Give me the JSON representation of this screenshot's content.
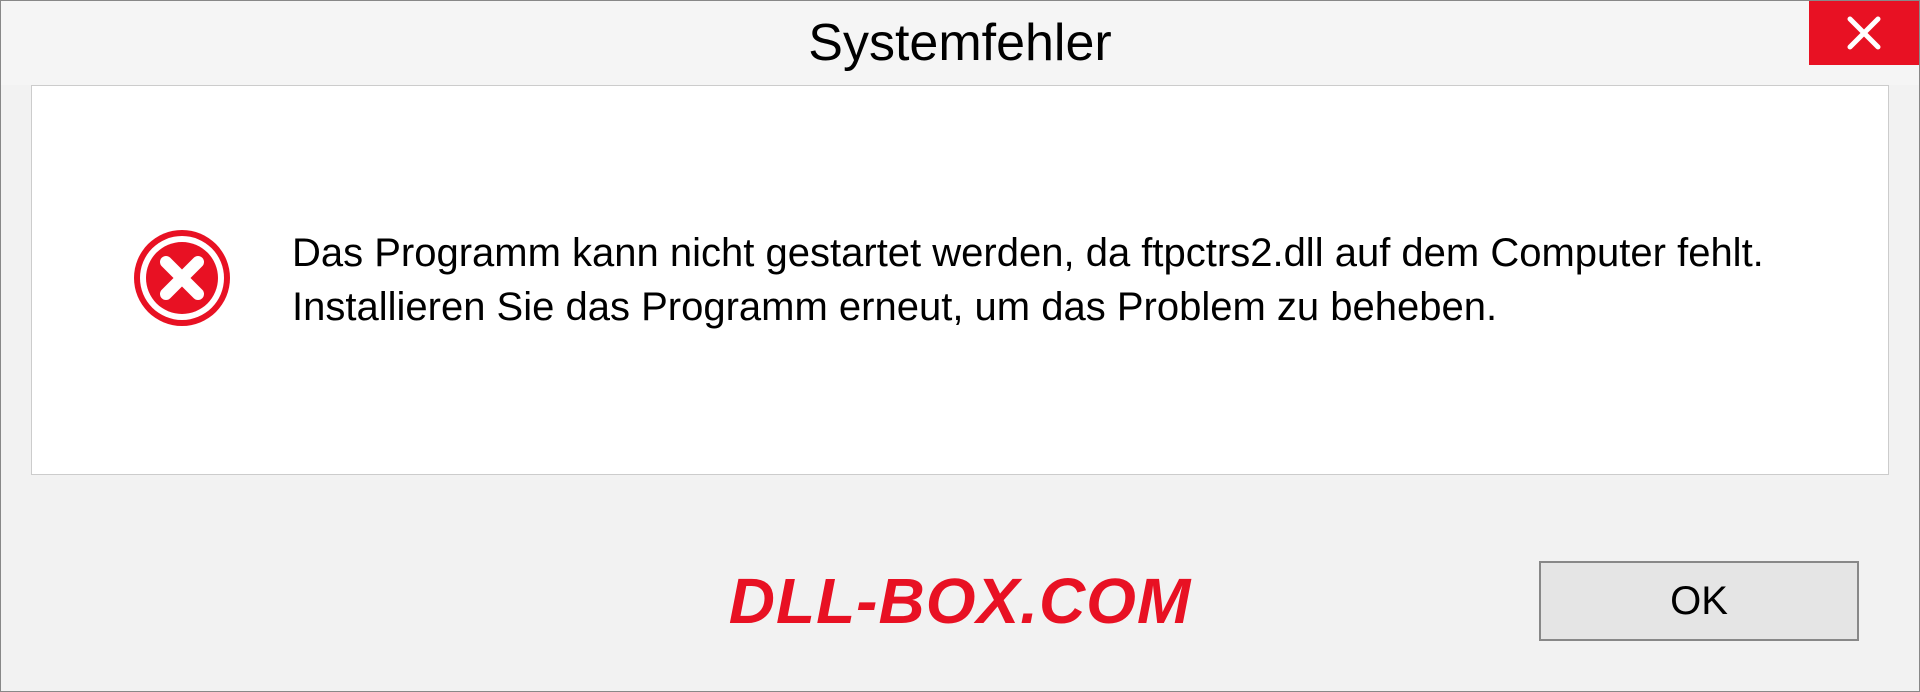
{
  "dialog": {
    "title": "Systemfehler",
    "message": "Das Programm kann nicht gestartet werden, da ftpctrs2.dll auf dem Computer fehlt. Installieren Sie das Programm erneut, um das Problem zu beheben.",
    "ok_label": "OK"
  },
  "watermark": "DLL-BOX.COM"
}
